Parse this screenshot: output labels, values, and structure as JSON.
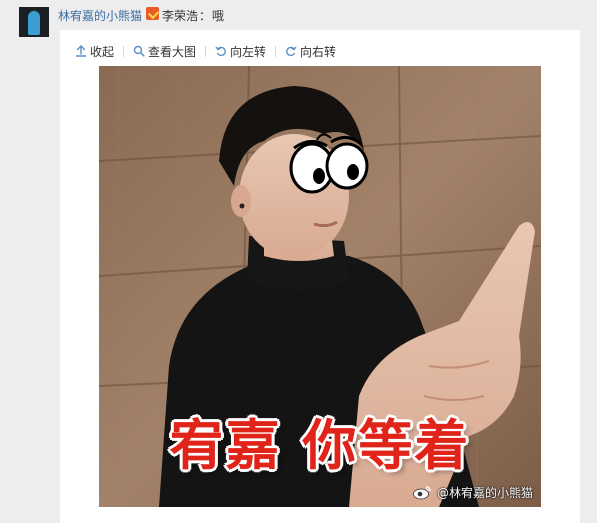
{
  "post": {
    "username": "林宥嘉的小熊猫",
    "badge_icon": "vip-badge-icon",
    "reply_to": "李荣浩",
    "colon": "：",
    "reply_body": "哦"
  },
  "toolbar": {
    "collapse_label": "收起",
    "view_large_label": "查看大图",
    "rotate_left_label": "向左转",
    "rotate_right_label": "向右转"
  },
  "image": {
    "caption_text": "宥嘉 你等着",
    "watermark": "@林宥嘉的小熊猫",
    "accent_red": "#e0241a"
  },
  "colors": {
    "link": "#3b6ea5",
    "background": "#ededed",
    "card": "#ffffff"
  }
}
